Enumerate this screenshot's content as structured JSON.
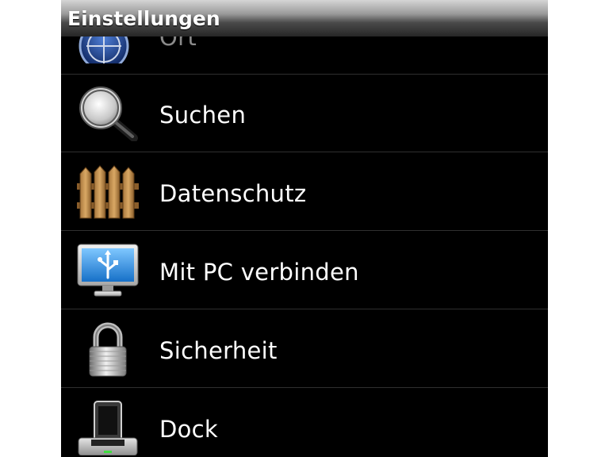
{
  "header": {
    "title": "Einstellungen"
  },
  "settings_items": [
    {
      "label": "Ort",
      "icon": "location-icon"
    },
    {
      "label": "Suchen",
      "icon": "magnifier-icon"
    },
    {
      "label": "Datenschutz",
      "icon": "fence-icon"
    },
    {
      "label": "Mit PC verbinden",
      "icon": "monitor-usb-icon"
    },
    {
      "label": "Sicherheit",
      "icon": "padlock-icon"
    },
    {
      "label": "Dock",
      "icon": "dock-icon"
    }
  ]
}
